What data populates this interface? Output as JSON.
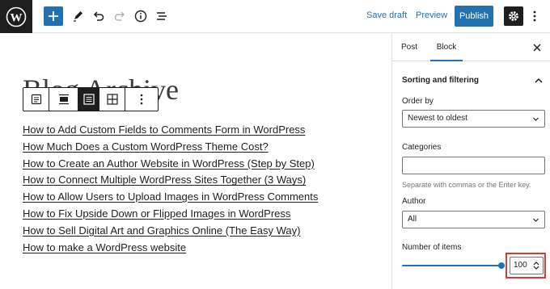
{
  "topbar": {
    "save_draft": "Save draft",
    "preview": "Preview",
    "publish": "Publish"
  },
  "block": {
    "title": "Blog Archive",
    "posts": [
      "How to Add Custom Fields to Comments Form in WordPress",
      "How Much Does a Custom WordPress Theme Cost?",
      "How to Create an Author Website in WordPress (Step by Step)",
      "How to Connect Multiple WordPress Sites Together (3 Ways)",
      "How to Allow Users to Upload Images in WordPress Comments",
      "How to Fix Upside Down or Flipped Images in WordPress",
      "How to Sell Digital Art and Graphics Online (The Easy Way)",
      "How to make a WordPress website"
    ]
  },
  "sidebar": {
    "tab_post": "Post",
    "tab_block": "Block",
    "panel_title": "Sorting and filtering",
    "order_by_label": "Order by",
    "order_by_value": "Newest to oldest",
    "categories_label": "Categories",
    "categories_help": "Separate with commas or the Enter key.",
    "author_label": "Author",
    "author_value": "All",
    "number_label": "Number of items",
    "number_value": "100",
    "number_level_fraction": 1.0
  },
  "colors": {
    "accent": "#2271b1",
    "dark": "#1e1e1e",
    "highlight": "#e03a2e"
  }
}
